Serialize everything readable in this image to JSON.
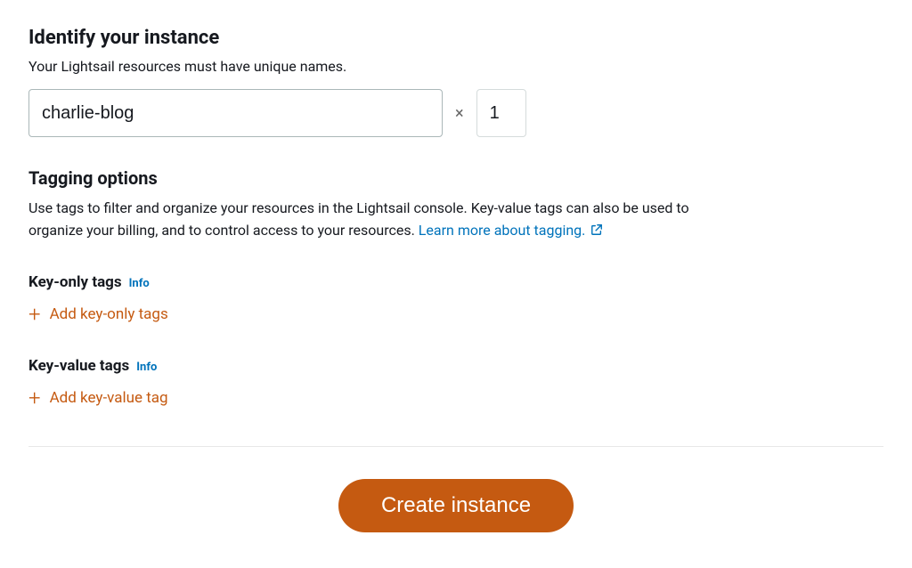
{
  "identify": {
    "heading": "Identify your instance",
    "subtext": "Your Lightsail resources must have unique names.",
    "name_value": "charlie-blog",
    "multiply_symbol": "×",
    "count_value": "1"
  },
  "tagging": {
    "heading": "Tagging options",
    "description_1": "Use tags to filter and organize your resources in the Lightsail console. Key-value tags can also be used to organize your billing, and to control access to your resources. ",
    "learn_more_label": "Learn more about tagging."
  },
  "key_only": {
    "title": "Key-only tags",
    "info": "Info",
    "add_label": "Add key-only tags"
  },
  "key_value": {
    "title": "Key-value tags",
    "info": "Info",
    "add_label": "Add key-value tag"
  },
  "create_button": "Create instance"
}
